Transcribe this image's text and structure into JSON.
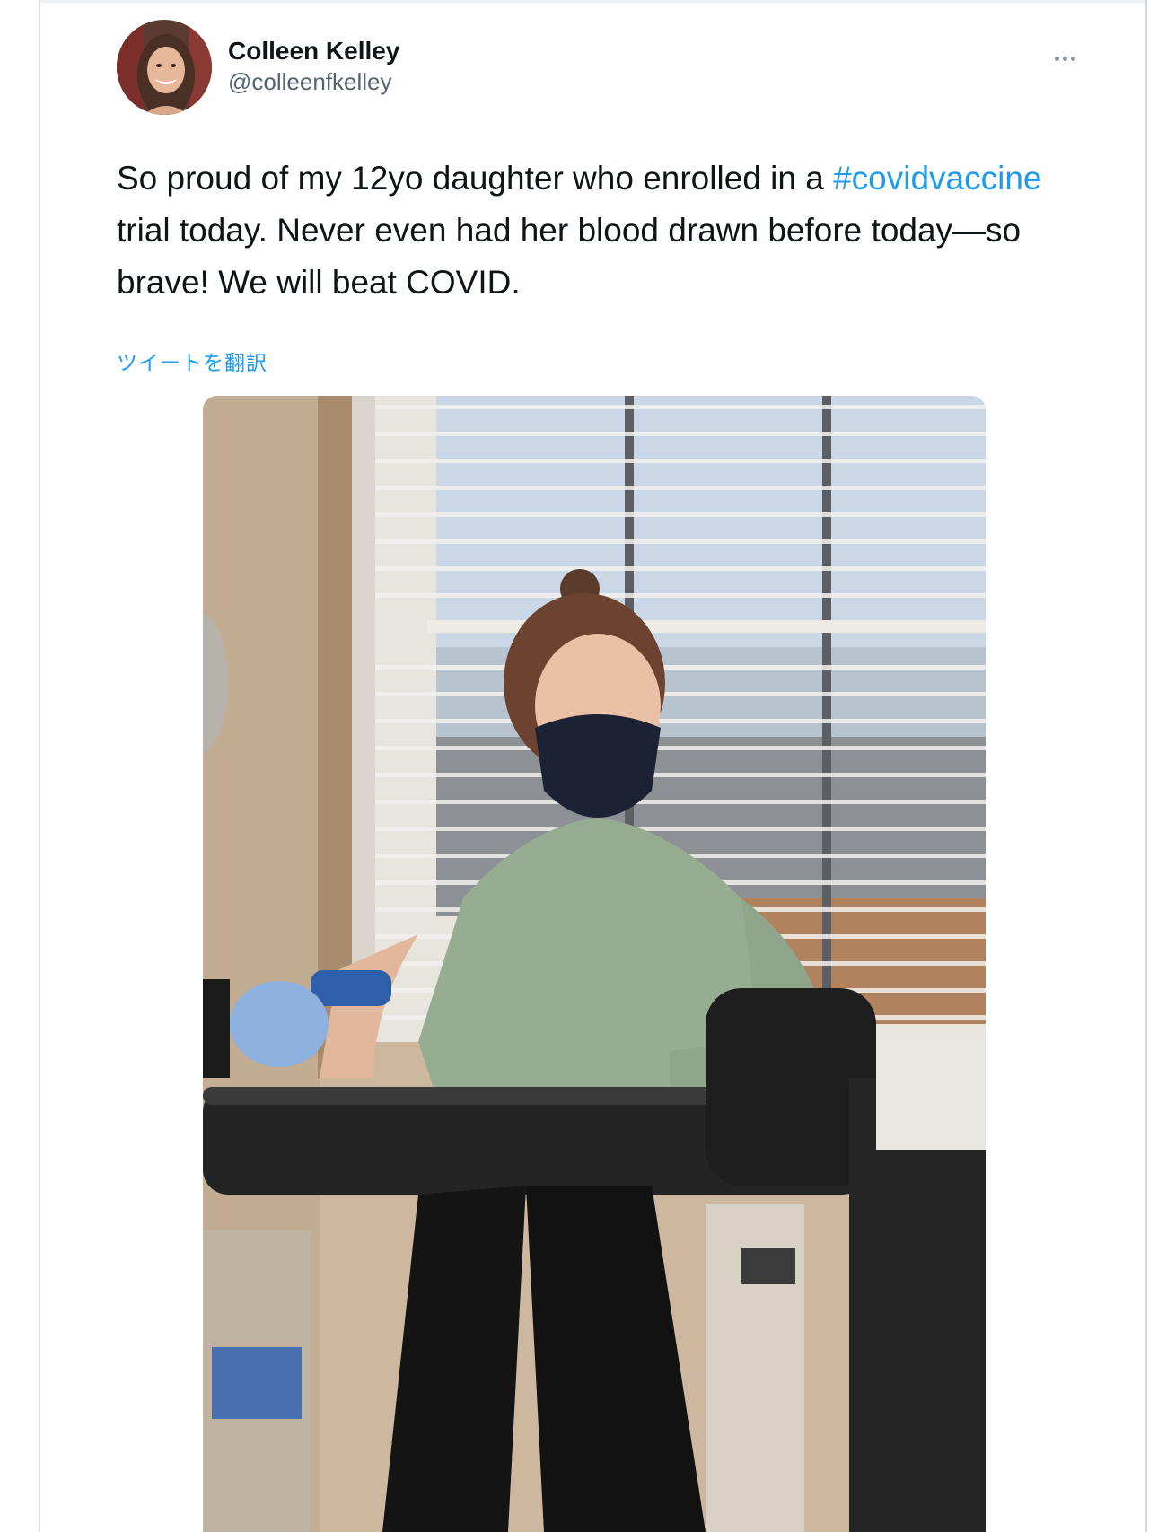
{
  "tweet": {
    "author": {
      "name": "Colleen Kelley",
      "handle": "@colleenfkelley"
    },
    "text_before_hashtag": "So proud of my 12yo daughter who enrolled in a ",
    "hashtag": "#covidvaccine",
    "text_after_hashtag": " trial today. Never even had her blood drawn before today—so brave! We will beat COVID.",
    "translate_label": "ツイートを翻訳",
    "more_icon": "more-horizontal-icon",
    "link_color": "#1d9bf0"
  }
}
